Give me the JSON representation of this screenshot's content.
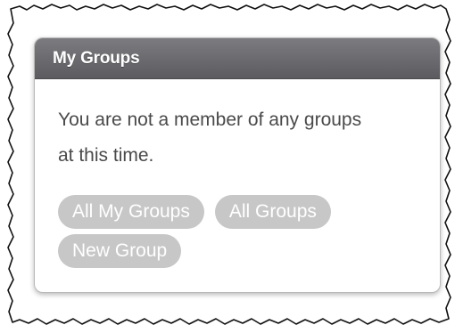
{
  "widget": {
    "title": "My Groups",
    "message": "You are not a member of any groups at this time.",
    "buttons": {
      "all_my_groups": "All My Groups",
      "all_groups": "All Groups",
      "new_group": "New Group"
    }
  },
  "colors": {
    "header_bg": "#66666a",
    "header_text": "#ffffff",
    "body_text": "#4a4a4a",
    "button_bg": "#c7c7c7",
    "button_text": "#ffffff"
  }
}
